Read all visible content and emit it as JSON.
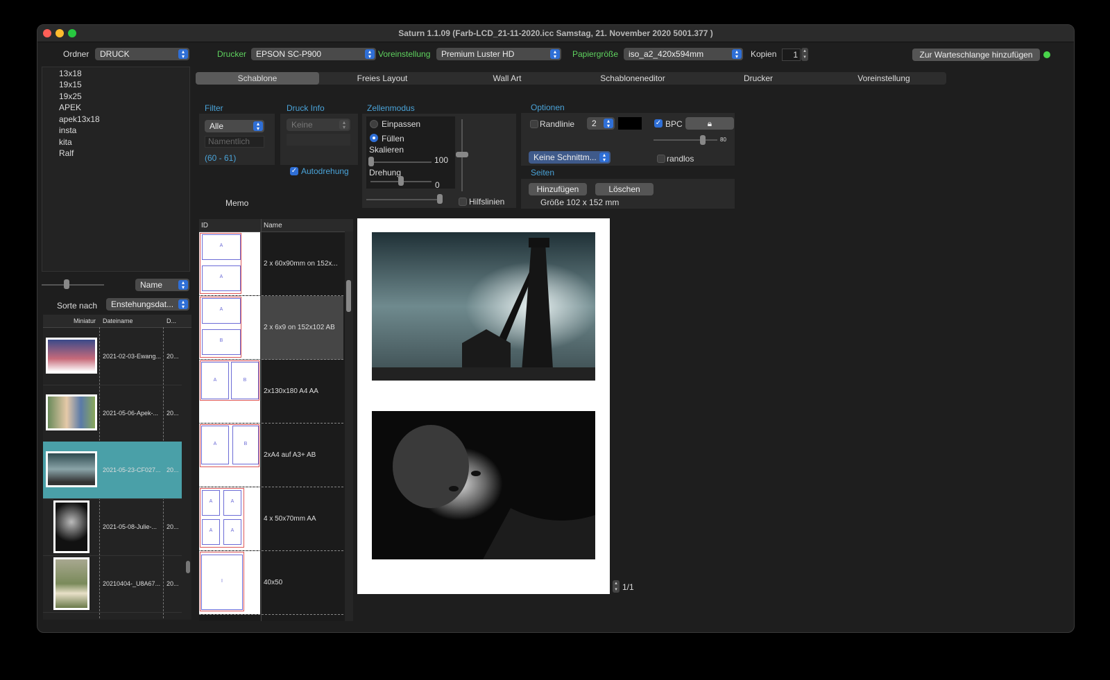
{
  "window": {
    "title": "Saturn 1.1.09 (Farb-LCD_21-11-2020.icc Samstag, 21. November 2020  5001.377 )"
  },
  "toolbar": {
    "ordner_label": "Ordner",
    "ordner_value": "DRUCK",
    "drucker_label": "Drucker",
    "drucker_value": "EPSON SC-P900",
    "voreinstellung_label": "Voreinstellung",
    "voreinstellung_value": "Premium Luster HD",
    "papier_label": "Papiergröße",
    "papier_value": "iso_a2_420x594mm",
    "kopien_label": "Kopien",
    "kopien_value": "1",
    "queue_button": "Zur Warteschlange hinzufügen"
  },
  "folders": [
    "13x18",
    "19x15",
    "19x25",
    "APEK",
    "apek13x18",
    "insta",
    "kita",
    "Ralf"
  ],
  "left": {
    "sort_field": "Name",
    "sort_label": "Sorte nach",
    "sort_value": "Enstehungsdat...",
    "col_thumb": "Miniatur",
    "col_file": "Dateiname",
    "col_d": "D...",
    "files": [
      {
        "name": "2021-02-03-Ewang...",
        "d": "20..."
      },
      {
        "name": "2021-05-06-Apek-...",
        "d": "20..."
      },
      {
        "name": "2021-05-23-CF027...",
        "d": "20..."
      },
      {
        "name": "2021-05-08-Julie-...",
        "d": "20..."
      },
      {
        "name": "20210404-_U8A67...",
        "d": "20..."
      }
    ]
  },
  "tabs": [
    "Schablone",
    "Freies Layout",
    "Wall Art",
    "Schabloneneditor",
    "Drucker",
    "Voreinstellung"
  ],
  "filter": {
    "label": "Filter",
    "value": "Alle",
    "placeholder": "Namentlich",
    "range": "(60 - 61)"
  },
  "druckinfo": {
    "label": "Druck Info",
    "value": "Keine",
    "autodrehung": "Autodrehung"
  },
  "zellenmodus": {
    "label": "Zellenmodus",
    "einpassen": "Einpassen",
    "fuellen": "Füllen",
    "skalieren": "Skalieren",
    "skalieren_value": "100",
    "drehung": "Drehung",
    "drehung_value": "0",
    "hilfslinien": "Hilfslinien"
  },
  "optionen": {
    "label": "Optionen",
    "randlinie": "Randlinie",
    "randlinie_value": "2",
    "bpc": "BPC",
    "slider_value": "80",
    "schnitt": "Keine Schnittm...",
    "randlos": "randlos"
  },
  "seiten": {
    "label": "Seiten",
    "add": "Hinzufügen",
    "delete": "Löschen",
    "size": "Größe  102 x 152 mm"
  },
  "memo": "Memo",
  "templates": {
    "col_id": "ID",
    "col_name": "Name",
    "rows": [
      {
        "name": "2 x 60x90mm on 152x..."
      },
      {
        "name": "2 x 6x9 on 152x102 AB"
      },
      {
        "name": "2x130x180 A4 AA"
      },
      {
        "name": "2xA4 auf A3+ AB"
      },
      {
        "name": "4 x 50x70mm AA"
      },
      {
        "name": "40x50"
      }
    ],
    "box_labels": {
      "a": "A",
      "b": "B",
      "i": "I"
    }
  },
  "preview": {
    "page": "1/1"
  },
  "colors": {
    "accent": "#2f6fd6",
    "selection": "#4aa0a8",
    "green_label": "#5fd35f",
    "blue_label": "#4aa3d8"
  }
}
